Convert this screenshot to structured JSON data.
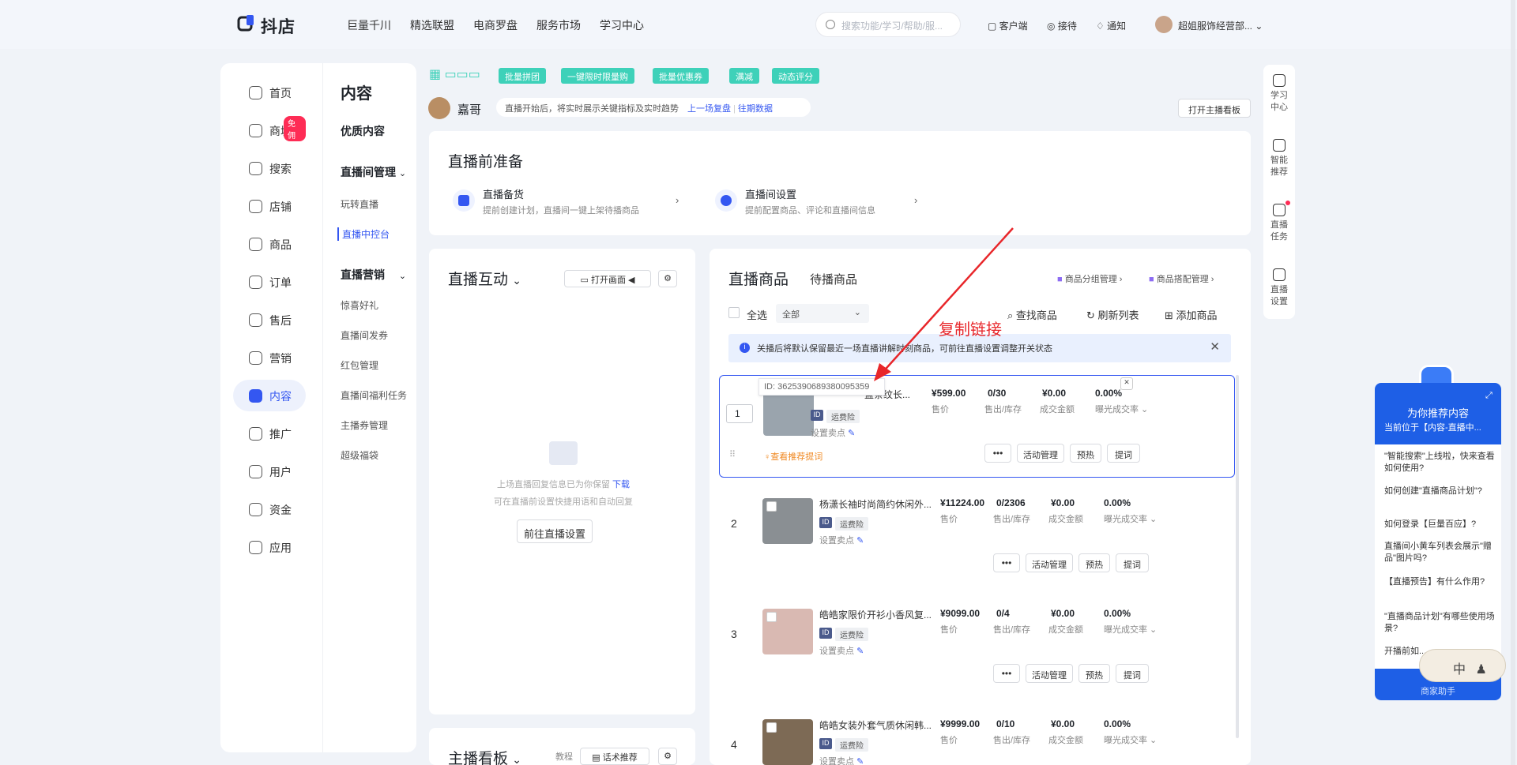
{
  "header": {
    "logo_text": "抖店",
    "nav": [
      "巨量千川",
      "精选联盟",
      "电商罗盘",
      "服务市场",
      "学习中心"
    ],
    "search_placeholder": "搜索功能/学习/帮助/服...",
    "actions": [
      "客户端",
      "接待",
      "通知"
    ],
    "user_name": "超姐服饰经营部..."
  },
  "sidebar": {
    "items": [
      {
        "label": "首页",
        "icon": "home-icon"
      },
      {
        "label": "商城",
        "icon": "mall-icon",
        "badge": "免佣"
      },
      {
        "label": "搜索",
        "icon": "search-icon"
      },
      {
        "label": "店铺",
        "icon": "shop-icon"
      },
      {
        "label": "商品",
        "icon": "product-icon"
      },
      {
        "label": "订单",
        "icon": "order-icon"
      },
      {
        "label": "售后",
        "icon": "aftersale-icon"
      },
      {
        "label": "营销",
        "icon": "marketing-icon"
      },
      {
        "label": "内容",
        "icon": "content-icon",
        "active": true
      },
      {
        "label": "推广",
        "icon": "promote-icon"
      },
      {
        "label": "用户",
        "icon": "user-icon"
      },
      {
        "label": "资金",
        "icon": "wallet-icon"
      },
      {
        "label": "应用",
        "icon": "app-icon"
      }
    ],
    "sub": {
      "title": "内容",
      "quality": "优质内容",
      "group1": "直播间管理",
      "group1_items": [
        "玩转直播",
        "直播中控台"
      ],
      "group2": "直播营销",
      "group2_items": [
        "惊喜好礼",
        "直播间发券",
        "红包管理",
        "直播间福利任务",
        "主播券管理",
        "超级福袋"
      ]
    }
  },
  "promo": {
    "chips": [
      "批量拼团",
      "一键限时限量购",
      "批量优惠券",
      "满减",
      "动态评分"
    ]
  },
  "streamer": {
    "name": "嘉哥",
    "notice": "直播开始后，将实时展示关键指标及实时趋势",
    "link1": "上一场复盘",
    "link2": "往期数据",
    "open_board": "打开主播看板"
  },
  "prep": {
    "title": "直播前准备",
    "items": [
      {
        "title": "直播备货",
        "desc": "提前创建计划，直播间一键上架待播商品"
      },
      {
        "title": "直播间设置",
        "desc": "提前配置商品、评论和直播间信息"
      }
    ]
  },
  "interaction": {
    "title": "直播互动",
    "open_screen": "打开画面",
    "empty_line1": "上场直播回复信息已为你保留",
    "download": "下载",
    "empty_line2": "可在直播前设置快捷用语和自动回复",
    "goto_settings": "前往直播设置"
  },
  "board": {
    "title": "主播看板",
    "tutorial": "教程",
    "script": "话术推荐"
  },
  "products": {
    "tab_active": "直播商品",
    "tab_other": "待播商品",
    "group_mgmt": "商品分组管理",
    "combo_mgmt": "商品搭配管理",
    "select_all": "全选",
    "filter_value": "全部",
    "find": "查找商品",
    "refresh": "刷新列表",
    "add": "添加商品",
    "info": "关播后将默认保留最近一场直播讲解时刻商品，可前往直播设置调整开关状态",
    "annotation": "复制链接",
    "id_tooltip": "ID: 3625390689380095359",
    "col_labels": [
      "售价",
      "售出/库存",
      "成交金额",
      "曝光成交率"
    ],
    "set_selling_point": "设置卖点",
    "insurance": "运费险",
    "id_badge": "ID",
    "recommend_prompt": "查看推荐提词",
    "actions": [
      "•••",
      "活动管理",
      "预热",
      "提词"
    ],
    "rows": [
      {
        "index": "1",
        "name": "蓝条纹长...",
        "price": "¥599.00",
        "sold": "0/30",
        "amount": "¥0.00",
        "rate": "0.00%",
        "thumb": "#9aa4ad"
      },
      {
        "index": "2",
        "name": "杨潇长袖时尚简约休闲外...",
        "price": "¥11224.00",
        "sold": "0/2306",
        "amount": "¥0.00",
        "rate": "0.00%",
        "thumb": "#8a8f93"
      },
      {
        "index": "3",
        "name": "皓皓家限价开衫小香风复...",
        "price": "¥9099.00",
        "sold": "0/4",
        "amount": "¥0.00",
        "rate": "0.00%",
        "thumb": "#d9b9b2"
      },
      {
        "index": "4",
        "name": "皓皓女装外套气质休闲韩...",
        "price": "¥9999.00",
        "sold": "0/10",
        "amount": "¥0.00",
        "rate": "0.00%",
        "thumb": "#7d6a55"
      }
    ]
  },
  "rail": [
    {
      "label": "学习中心",
      "icon": "book-icon"
    },
    {
      "label": "智能推荐",
      "icon": "robot-icon"
    },
    {
      "label": "直播任务",
      "icon": "task-icon"
    },
    {
      "label": "直播设置",
      "icon": "settings-icon"
    }
  ],
  "assistant": {
    "title": "为你推荐内容",
    "subtitle": "当前位于【内容-直播中...",
    "questions": [
      "\"智能搜索\"上线啦，快来查看如何使用?",
      "如何创建\"直播商品计划\"?",
      "如何登录【巨量百应】?",
      "直播间小黄车列表会展示\"赠品\"图片吗?",
      "【直播预告】有什么作用?",
      "\"直播商品计划\"有哪些使用场景?",
      "开播前如..."
    ],
    "footer": "商家助手",
    "ime_label": "中"
  },
  "colors": {
    "primary": "#3457f1",
    "teal": "#3ed1b9",
    "red_annotation": "#e8262a"
  }
}
